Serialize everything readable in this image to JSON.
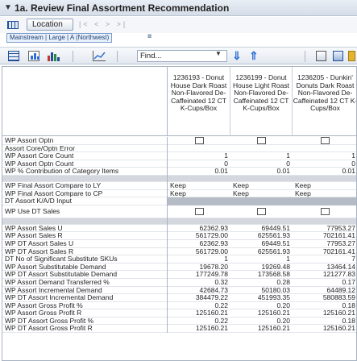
{
  "title": "1a. Review Final Assortment Recommendation",
  "location_button": "Location",
  "nav_symbols": "|< < > >|",
  "filter_chip": "Mainstream | Large | A (Northwest)",
  "filter_eq": "=",
  "toolbar": {
    "find_text": "Find..."
  },
  "columns": [
    "1236193 - Donut House Dark Roast Non-Flavored De-Caffeinated 12 CT K-Cups/Box",
    "1236199 - Donut House Light Roast Non-Flavored De-Caffeinated 12 CT K-Cups/Box",
    "1236205 - Dunkin' Donuts Dark Roast Non-Flavored De-Caffeinated 12 CT K-Cups/Box"
  ],
  "rows": [
    {
      "label": "WP Assort Optn",
      "type": "checkbox",
      "values": [
        "",
        "",
        ""
      ]
    },
    {
      "label": "Assort Core/Optn Error",
      "type": "num",
      "values": [
        "",
        "",
        ""
      ]
    },
    {
      "label": "WP Assort Core Count",
      "type": "num",
      "values": [
        "1",
        "1",
        "1"
      ]
    },
    {
      "label": "WP Assort Optn Count",
      "type": "num",
      "values": [
        "0",
        "0",
        "0"
      ]
    },
    {
      "label": "WP % Contribution of Category Items",
      "type": "num",
      "values": [
        "0.01",
        "0.01",
        "0.01"
      ]
    },
    {
      "label": "",
      "type": "section",
      "values": [
        "",
        "",
        ""
      ]
    },
    {
      "label": "WP Final Assort Compare to LY",
      "type": "text",
      "values": [
        "Keep",
        "Keep",
        "Keep"
      ]
    },
    {
      "label": "WP Final Assort Compare to CP",
      "type": "text",
      "values": [
        "Keep",
        "Keep",
        "Keep"
      ]
    },
    {
      "label": "DT Assort K/A/D Input",
      "type": "text",
      "values": [
        "",
        "",
        ""
      ]
    },
    {
      "label": "WP Use DT Sales",
      "type": "checkbox",
      "values": [
        "",
        "",
        ""
      ]
    },
    {
      "label": "",
      "type": "section",
      "values": [
        "",
        "",
        ""
      ]
    },
    {
      "label": "WP Assort Sales U",
      "type": "num",
      "values": [
        "62362.93",
        "69449.51",
        "77953.27"
      ]
    },
    {
      "label": "WP Assort Sales R",
      "type": "num",
      "values": [
        "561729.00",
        "625561.93",
        "702161.41"
      ]
    },
    {
      "label": "WP DT Assort Sales U",
      "type": "num",
      "values": [
        "62362.93",
        "69449.51",
        "77953.27"
      ]
    },
    {
      "label": "WP DT Assort Sales R",
      "type": "num",
      "values": [
        "561729.00",
        "625561.93",
        "702161.41"
      ]
    },
    {
      "label": "DT No of Significant Substitute SKUs",
      "type": "num",
      "values": [
        "1",
        "1",
        "7"
      ]
    },
    {
      "label": "WP Assort Substitutable Demand",
      "type": "num",
      "values": [
        "19678.20",
        "19269.48",
        "13464.14"
      ]
    },
    {
      "label": "WP DT Assort Substitutable Demand",
      "type": "num",
      "values": [
        "177249.78",
        "173568.58",
        "121277.83"
      ]
    },
    {
      "label": "WP Assort Demand Transferred %",
      "type": "num",
      "values": [
        "0.32",
        "0.28",
        "0.17"
      ]
    },
    {
      "label": "WP Assort Incremental Demand",
      "type": "num",
      "values": [
        "42684.73",
        "50180.03",
        "64489.12"
      ]
    },
    {
      "label": "WP DT Assort Incremental Demand",
      "type": "num",
      "values": [
        "384479.22",
        "451993.35",
        "580883.59"
      ]
    },
    {
      "label": "WP Assort Gross Profit %",
      "type": "num",
      "values": [
        "0.22",
        "0.20",
        "0.18"
      ]
    },
    {
      "label": "WP Assort Gross Profit R",
      "type": "num",
      "values": [
        "125160.21",
        "125160.21",
        "125160.21"
      ]
    },
    {
      "label": "WP DT Assort Gross Profit %",
      "type": "num",
      "values": [
        "0.22",
        "0.20",
        "0.18"
      ]
    },
    {
      "label": "WP DT Assort Gross Profit R",
      "type": "num",
      "values": [
        "125160.21",
        "125160.21",
        "125160.21"
      ]
    }
  ]
}
